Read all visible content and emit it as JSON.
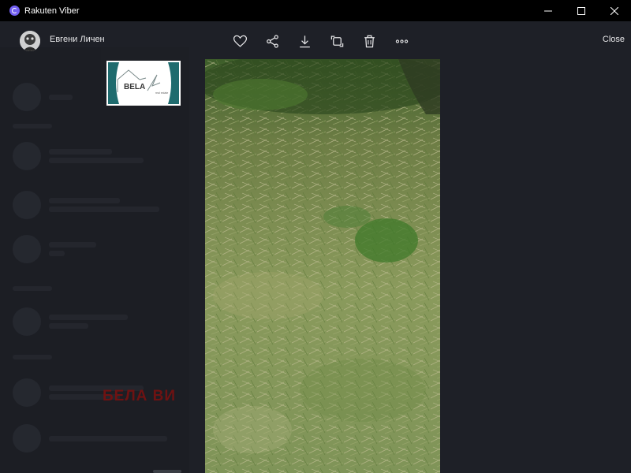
{
  "window": {
    "title": "Rakuten Viber",
    "minimize_icon": "minimize-icon",
    "maximize_icon": "maximize-icon",
    "close_icon": "close-icon"
  },
  "viewer": {
    "sender_name": "Евгени Личен",
    "close_label": "Close",
    "toolbar_icons": [
      "heart-icon",
      "share-icon",
      "download-icon",
      "forward-icon",
      "trash-icon",
      "more-icon"
    ]
  },
  "logo": {
    "text": "BELA",
    "subtext": "real estate"
  },
  "watermark": "БЕЛА ВИ",
  "colors": {
    "background": "#1e2027",
    "titlebar": "#000000",
    "viber_purple": "#7360f2",
    "logo_teal": "#1f6b6e",
    "watermark_red": "#6e1212"
  }
}
